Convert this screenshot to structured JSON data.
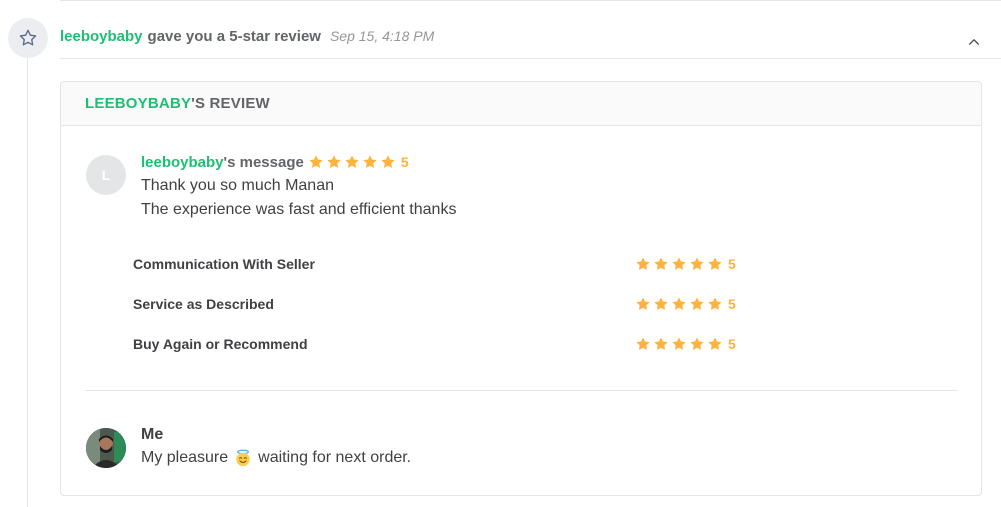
{
  "event": {
    "icon": "star-outline-icon",
    "user": "leeboybaby",
    "action": "gave you a 5-star review",
    "timestamp": "Sep 15, 4:18 PM",
    "collapse_icon": "chevron-up-icon"
  },
  "review": {
    "header_user": "LEEBOYBABY",
    "header_suffix": "'S REVIEW",
    "buyer": {
      "avatar_initial": "L",
      "username": "leeboybaby",
      "label": "'s message",
      "rating": "5",
      "lines": [
        "Thank you so much Manan",
        "The experience was fast and efficient thanks"
      ]
    },
    "criteria": [
      {
        "name": "Communication With Seller",
        "rating": "5"
      },
      {
        "name": "Service as Described",
        "rating": "5"
      },
      {
        "name": "Buy Again or Recommend",
        "rating": "5"
      }
    ],
    "seller": {
      "name": "Me",
      "message_before": "My pleasure",
      "emoji": "smiling-face-with-halo-emoji",
      "message_after": "waiting for next order."
    }
  },
  "colors": {
    "brand_green": "#1dbf73",
    "star_gold": "#ffb33e",
    "text_dark": "#404145",
    "text_muted": "#62646a",
    "border": "#e4e5e7"
  }
}
